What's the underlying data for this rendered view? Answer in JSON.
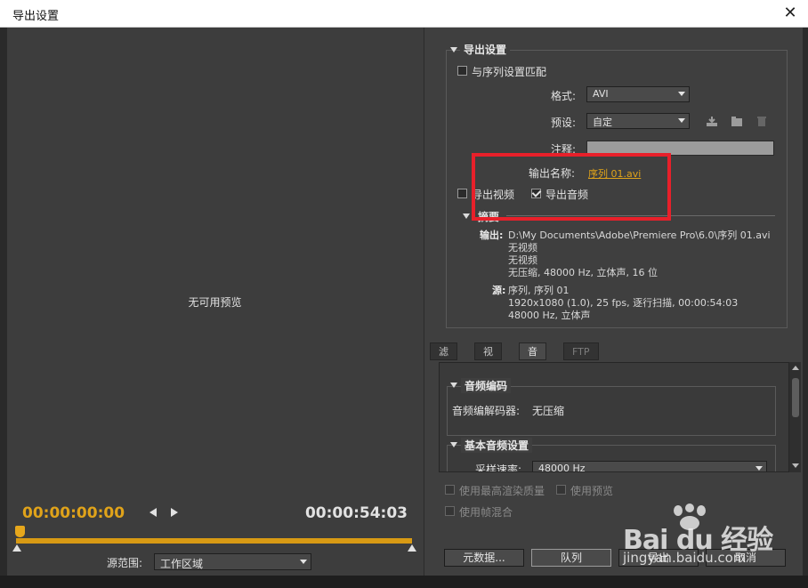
{
  "window": {
    "title": "导出设置",
    "close_glyph": "✕"
  },
  "preview": {
    "no_preview_text": "无可用预览",
    "timecode_start": "00:00:00:00",
    "timecode_end": "00:00:54:03",
    "source_range_label": "源范围:",
    "source_range_value": "工作区域"
  },
  "export_settings": {
    "section_title": "导出设置",
    "match_sequence_label": "与序列设置匹配",
    "match_sequence_checked": false,
    "format_label": "格式:",
    "format_value": "AVI",
    "preset_label": "预设:",
    "preset_value": "自定",
    "comments_label": "注释:",
    "comments_value": "",
    "output_name_label": "输出名称:",
    "output_name_value": "序列 01.avi",
    "export_video_label": "导出视频",
    "export_video_checked": false,
    "export_audio_label": "导出音频",
    "export_audio_checked": true,
    "icons": [
      "save-preset-icon",
      "import-preset-icon",
      "delete-preset-icon"
    ]
  },
  "summary": {
    "title": "摘要",
    "output_key": "输出:",
    "output_lines": [
      "D:\\My Documents\\Adobe\\Premiere Pro\\6.0\\序列 01.avi",
      "无视频",
      "无视频",
      "无压缩, 48000 Hz, 立体声, 16 位"
    ],
    "source_key": "源:",
    "source_lines": [
      "序列, 序列 01",
      "1920x1080 (1.0), 25 fps, 逐行扫描, 00:00:54:03",
      "48000 Hz, 立体声"
    ]
  },
  "tabs": [
    {
      "label": "滤镜",
      "active": false,
      "disabled": false
    },
    {
      "label": "视频",
      "active": false,
      "disabled": false
    },
    {
      "label": "音频",
      "active": true,
      "disabled": false
    },
    {
      "label": "FTP",
      "active": false,
      "disabled": true
    }
  ],
  "audio": {
    "codec_section": "音频编码",
    "codec_label": "音频编解码器:",
    "codec_value": "无压缩",
    "basic_section": "基本音频设置",
    "sample_rate_label": "采样速率:",
    "sample_rate_value": "48000 Hz"
  },
  "options": {
    "max_render_quality": "使用最高渲染质量",
    "use_previews": "使用预览",
    "frame_blending": "使用帧混合"
  },
  "buttons": {
    "metadata": "元数据...",
    "queue": "队列",
    "export": "导出",
    "cancel": "取消"
  },
  "watermark": {
    "brand": "Bai du 经验",
    "url": "jingyan.baidu.com"
  },
  "colors": {
    "accent": "#e0a31a",
    "highlight": "#e8202a",
    "panel": "#3f3f3f"
  }
}
